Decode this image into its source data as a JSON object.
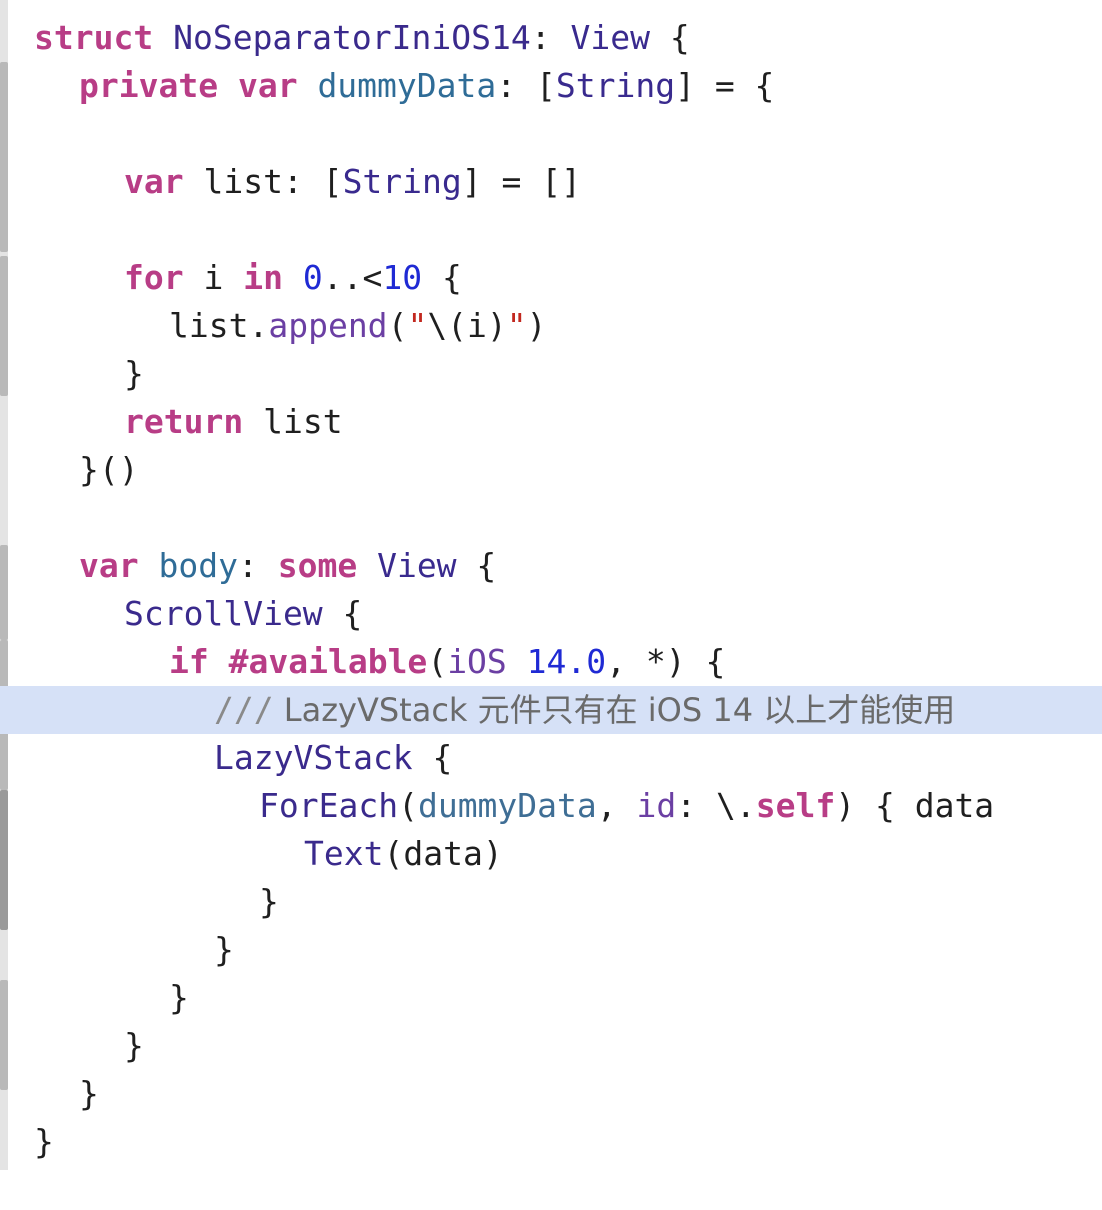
{
  "editor": {
    "language": "Swift",
    "highlight_color": "#d6e1f7",
    "lines": [
      {
        "indent": 0,
        "tokens": [
          {
            "t": "struct",
            "c": "kw"
          },
          {
            "t": " ",
            "c": "pl"
          },
          {
            "t": "NoSeparatorIniOS14",
            "c": "ty"
          },
          {
            "t": ": ",
            "c": "pl"
          },
          {
            "t": "View",
            "c": "ty2"
          },
          {
            "t": " {",
            "c": "pl"
          }
        ]
      },
      {
        "indent": 1,
        "tokens": [
          {
            "t": "private",
            "c": "kw"
          },
          {
            "t": " ",
            "c": "pl"
          },
          {
            "t": "var",
            "c": "kw"
          },
          {
            "t": " ",
            "c": "pl"
          },
          {
            "t": "dummyData",
            "c": "vr"
          },
          {
            "t": ": [",
            "c": "pl"
          },
          {
            "t": "String",
            "c": "ty2"
          },
          {
            "t": "] = {",
            "c": "pl"
          }
        ]
      },
      {
        "indent": 0,
        "tokens": []
      },
      {
        "indent": 2,
        "tokens": [
          {
            "t": "var",
            "c": "kw"
          },
          {
            "t": " list: [",
            "c": "pl"
          },
          {
            "t": "String",
            "c": "ty2"
          },
          {
            "t": "] = []",
            "c": "pl"
          }
        ]
      },
      {
        "indent": 0,
        "tokens": []
      },
      {
        "indent": 2,
        "tokens": [
          {
            "t": "for",
            "c": "kw"
          },
          {
            "t": " i ",
            "c": "pl"
          },
          {
            "t": "in",
            "c": "kw"
          },
          {
            "t": " ",
            "c": "pl"
          },
          {
            "t": "0",
            "c": "num"
          },
          {
            "t": "..<",
            "c": "pl"
          },
          {
            "t": "10",
            "c": "num"
          },
          {
            "t": " {",
            "c": "pl"
          }
        ]
      },
      {
        "indent": 3,
        "tokens": [
          {
            "t": "list.",
            "c": "pl"
          },
          {
            "t": "append",
            "c": "fn"
          },
          {
            "t": "(",
            "c": "pl"
          },
          {
            "t": "\"",
            "c": "str"
          },
          {
            "t": "\\(i)",
            "c": "pl"
          },
          {
            "t": "\"",
            "c": "str"
          },
          {
            "t": ")",
            "c": "pl"
          }
        ]
      },
      {
        "indent": 2,
        "tokens": [
          {
            "t": "}",
            "c": "pl"
          }
        ]
      },
      {
        "indent": 2,
        "tokens": [
          {
            "t": "return",
            "c": "kw"
          },
          {
            "t": " list",
            "c": "pl"
          }
        ]
      },
      {
        "indent": 1,
        "tokens": [
          {
            "t": "}()",
            "c": "pl"
          }
        ]
      },
      {
        "indent": 0,
        "tokens": []
      },
      {
        "indent": 1,
        "tokens": [
          {
            "t": "var",
            "c": "kw"
          },
          {
            "t": " ",
            "c": "pl"
          },
          {
            "t": "body",
            "c": "vr"
          },
          {
            "t": ": ",
            "c": "pl"
          },
          {
            "t": "some",
            "c": "kw"
          },
          {
            "t": " ",
            "c": "pl"
          },
          {
            "t": "View",
            "c": "ty2"
          },
          {
            "t": " {",
            "c": "pl"
          }
        ]
      },
      {
        "indent": 2,
        "tokens": [
          {
            "t": "ScrollView",
            "c": "ty"
          },
          {
            "t": " {",
            "c": "pl"
          }
        ]
      },
      {
        "indent": 3,
        "tokens": [
          {
            "t": "if",
            "c": "kw"
          },
          {
            "t": " ",
            "c": "pl"
          },
          {
            "t": "#available",
            "c": "kw"
          },
          {
            "t": "(",
            "c": "pl"
          },
          {
            "t": "iOS",
            "c": "fn"
          },
          {
            "t": " ",
            "c": "pl"
          },
          {
            "t": "14.0",
            "c": "num"
          },
          {
            "t": ", *) {",
            "c": "pl"
          }
        ]
      },
      {
        "indent": 4,
        "highlight": true,
        "tokens": [
          {
            "t": "///",
            "c": "cm"
          },
          {
            "t": " LazyVStack 元件只有在 iOS 14 以上才能使用",
            "c": "cm-text"
          }
        ]
      },
      {
        "indent": 4,
        "tokens": [
          {
            "t": "LazyVStack",
            "c": "ty"
          },
          {
            "t": " {",
            "c": "pl"
          }
        ]
      },
      {
        "indent": 5,
        "tokens": [
          {
            "t": "ForEach",
            "c": "ty"
          },
          {
            "t": "(",
            "c": "pl"
          },
          {
            "t": "dummyData",
            "c": "vr2"
          },
          {
            "t": ", ",
            "c": "pl"
          },
          {
            "t": "id",
            "c": "fn"
          },
          {
            "t": ": \\.",
            "c": "pl"
          },
          {
            "t": "self",
            "c": "kw"
          },
          {
            "t": ") { data",
            "c": "pl"
          }
        ]
      },
      {
        "indent": 6,
        "tokens": [
          {
            "t": "Text",
            "c": "ty"
          },
          {
            "t": "(data)",
            "c": "pl"
          }
        ]
      },
      {
        "indent": 5,
        "tokens": [
          {
            "t": "}",
            "c": "pl"
          }
        ]
      },
      {
        "indent": 4,
        "tokens": [
          {
            "t": "}",
            "c": "pl"
          }
        ]
      },
      {
        "indent": 3,
        "tokens": [
          {
            "t": "}",
            "c": "pl"
          }
        ]
      },
      {
        "indent": 2,
        "tokens": [
          {
            "t": "}",
            "c": "pl"
          }
        ]
      },
      {
        "indent": 1,
        "tokens": [
          {
            "t": "}",
            "c": "pl"
          }
        ]
      },
      {
        "indent": 0,
        "tokens": [
          {
            "t": "}",
            "c": "pl"
          }
        ]
      }
    ]
  }
}
